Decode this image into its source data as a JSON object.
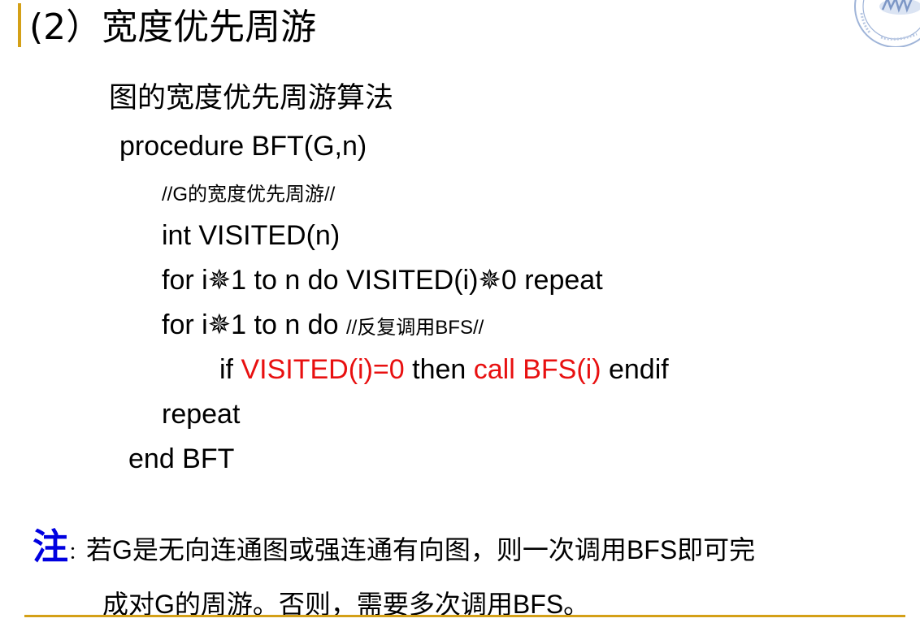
{
  "title": "(2）宽度优先周游",
  "heading": "图的宽度优先周游算法",
  "code": {
    "line1": "procedure BFT(G,n)",
    "comment1_prefix": "//G",
    "comment1_cjk": "的宽度优先周游",
    "comment1_suffix": "//",
    "line3": "int VISITED(n)",
    "line4": "for i✵1 to n do VISITED(i)✵0 repeat",
    "line5_code": "for i✵1 to n do ",
    "line5_comment_prefix": "//",
    "line5_comment_cjk": "反复调用",
    "line5_comment_suffix": "BFS//",
    "line6_if": "if ",
    "line6_cond": "VISITED(i)=0",
    "line6_then": " then ",
    "line6_call": "call BFS(i)",
    "line6_end": "  endif",
    "line7": "repeat",
    "line8": "end BFT"
  },
  "note": {
    "label": "注",
    "colon": "：",
    "text1_a": "若",
    "text1_b": "G",
    "text1_c": "是无向连通图或强连通有向图，则一次调用",
    "text1_d": "BFS",
    "text1_e": "即可完",
    "text2_a": "成对",
    "text2_b": "G",
    "text2_c": "的周游。否则，需要多次调用",
    "text2_d": "BFS",
    "text2_e": "。"
  },
  "colors": {
    "accent": "#d4a017",
    "highlight_red": "#e81010",
    "note_blue": "#0000e0",
    "logo_blue": "#9fb4d8"
  }
}
